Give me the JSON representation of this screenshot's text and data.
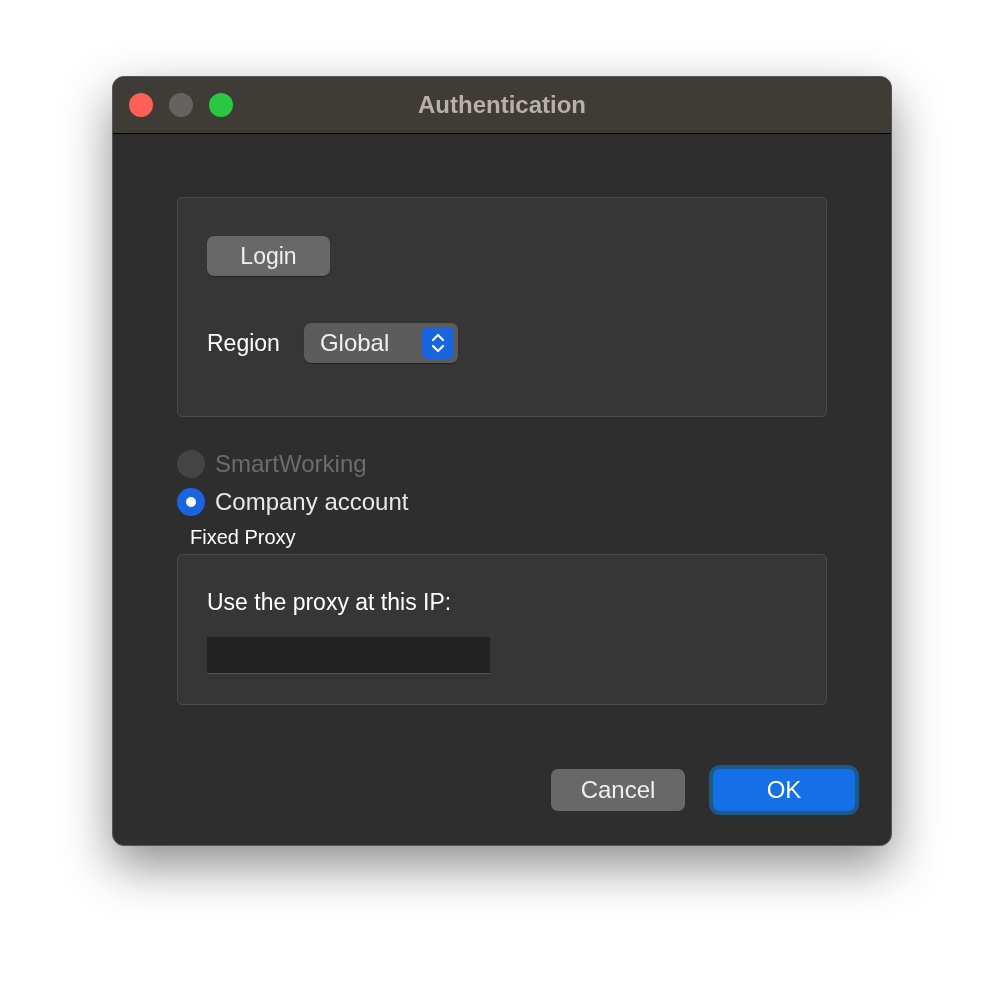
{
  "window": {
    "title": "Authentication"
  },
  "login_panel": {
    "login_button": "Login",
    "region_label": "Region",
    "region_select": {
      "value": "Global"
    }
  },
  "account_options": [
    {
      "label": "SmartWorking",
      "selected": false,
      "disabled": true
    },
    {
      "label": "Company account",
      "selected": true,
      "disabled": false
    }
  ],
  "proxy_group": {
    "title": "Fixed Proxy",
    "prompt": "Use the proxy at this IP:"
  },
  "buttons": [
    {
      "label": "Cancel",
      "default": false
    },
    {
      "label": "OK",
      "default": true
    }
  ]
}
